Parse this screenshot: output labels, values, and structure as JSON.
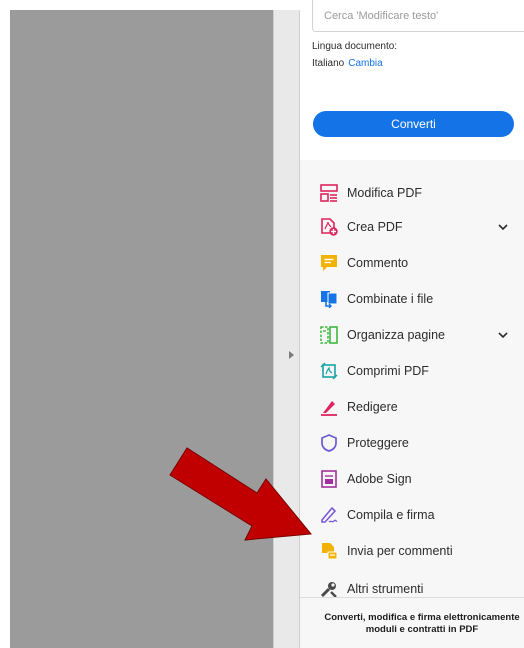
{
  "search": {
    "placeholder": "Cerca 'Modificare testo'"
  },
  "language": {
    "label": "Lingua documento:",
    "value": "Italiano",
    "change_link": "Cambia"
  },
  "convert_button": "Converti",
  "tools": [
    {
      "label": "Modifica PDF",
      "icon": "edit-pdf-icon",
      "color": "#e0245e",
      "expandable": false
    },
    {
      "label": "Crea PDF",
      "icon": "create-pdf-icon",
      "color": "#e0245e",
      "expandable": true
    },
    {
      "label": "Commento",
      "icon": "comment-icon",
      "color": "#f2b200",
      "expandable": false
    },
    {
      "label": "Combinate i file",
      "icon": "combine-files-icon",
      "color": "#1473e6",
      "expandable": false
    },
    {
      "label": "Organizza pagine",
      "icon": "organize-pages-icon",
      "color": "#3cb93c",
      "expandable": true
    },
    {
      "label": "Comprimi PDF",
      "icon": "compress-pdf-icon",
      "color": "#1aa3a3",
      "expandable": false
    },
    {
      "label": "Redigere",
      "icon": "redact-icon",
      "color": "#e0245e",
      "expandable": false
    },
    {
      "label": "Proteggere",
      "icon": "protect-shield-icon",
      "color": "#6b5bd6",
      "expandable": false
    },
    {
      "label": "Adobe Sign",
      "icon": "adobe-sign-icon",
      "color": "#a0309f",
      "expandable": false
    },
    {
      "label": "Compila e firma",
      "icon": "fill-sign-icon",
      "color": "#7a5ad6",
      "expandable": false
    },
    {
      "label": "Invia per commenti",
      "icon": "send-for-comments-icon",
      "color": "#f2b200",
      "expandable": false
    },
    {
      "label": "Altri strumenti",
      "icon": "more-tools-icon",
      "color": "#4a4a4a",
      "expandable": false
    }
  ],
  "footer": {
    "line1": "Converti, modifica e firma elettronicamente",
    "line2": "moduli e contratti in PDF"
  },
  "colors": {
    "accent": "#1473e6",
    "annotation_arrow": "#c00000"
  }
}
